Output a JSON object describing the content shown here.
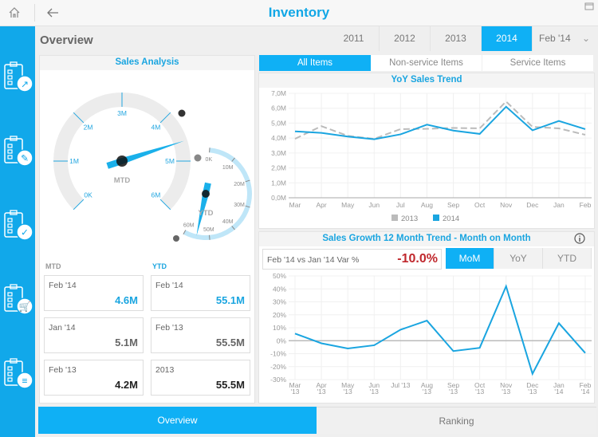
{
  "header": {
    "title": "Inventory",
    "home_icon": "home-icon",
    "back_icon": "back-arrow-icon"
  },
  "sidebar": {
    "items": [
      {
        "icon": "clipboard-trend-icon"
      },
      {
        "icon": "clipboard-tools-icon"
      },
      {
        "icon": "clipboard-check-icon"
      },
      {
        "icon": "clipboard-cart-icon"
      },
      {
        "icon": "clipboard-list-icon"
      }
    ]
  },
  "page_title": "Overview",
  "years": [
    "2011",
    "2012",
    "2013",
    "2014"
  ],
  "selected_year": "2014",
  "month_select": "Feb '14",
  "item_tabs": [
    "All Items",
    "Non-service Items",
    "Service Items"
  ],
  "sales_analysis": {
    "title": "Sales Analysis",
    "mtd_gauge": {
      "label": "MTD",
      "value": 4.6,
      "ticks": [
        "0K",
        "1M",
        "2M",
        "3M",
        "4M",
        "5M",
        "6M"
      ]
    },
    "ytd_gauge": {
      "label": "YTD",
      "value": 55.1,
      "ticks": [
        "0K",
        "10M",
        "20M",
        "30M",
        "40M",
        "50M",
        "60M"
      ]
    },
    "mtd_label": "MTD",
    "ytd_label": "YTD",
    "mtd_cards": [
      {
        "label": "Feb '14",
        "value": "4.6M"
      },
      {
        "label": "Jan '14",
        "value": "5.1M"
      },
      {
        "label": "Feb '13",
        "value": "4.2M"
      }
    ],
    "ytd_cards": [
      {
        "label": "Feb '14",
        "value": "55.1M"
      },
      {
        "label": "Feb '13",
        "value": "55.5M"
      },
      {
        "label": "2013",
        "value": "55.5M"
      }
    ]
  },
  "colors": {
    "accent": "#0fb0f5",
    "series_2013": "#bbbbbb",
    "series_2014": "#1aa5e0",
    "negative": "#c0282d"
  },
  "chart_data": [
    {
      "type": "line",
      "title": "YoY Sales Trend",
      "categories": [
        "Mar",
        "Apr",
        "May",
        "Jun",
        "Jul",
        "Aug",
        "Sep",
        "Oct",
        "Nov",
        "Dec",
        "Jan",
        "Feb"
      ],
      "yticks": [
        "0,0M",
        "1,0M",
        "2,0M",
        "3,0M",
        "4,0M",
        "5,0M",
        "6,0M",
        "7,0M"
      ],
      "ylim": [
        0,
        7
      ],
      "unit": "M",
      "grid": true,
      "legend": "bottom",
      "series": [
        {
          "name": "2013",
          "style": "dashed",
          "values": [
            3.95,
            4.8,
            4.15,
            3.95,
            4.6,
            4.62,
            4.68,
            4.65,
            6.45,
            4.75,
            4.65,
            4.22
          ]
        },
        {
          "name": "2014",
          "style": "solid",
          "values": [
            4.45,
            4.35,
            4.1,
            3.92,
            4.25,
            4.9,
            4.5,
            4.28,
            6.1,
            4.52,
            5.15,
            4.6
          ]
        }
      ]
    },
    {
      "type": "line",
      "title": "Sales Growth 12 Month Trend - Month on Month",
      "categories": [
        [
          "Mar",
          "'13"
        ],
        [
          "Apr",
          "'13"
        ],
        [
          "May",
          "'13"
        ],
        [
          "Jun",
          "'13"
        ],
        [
          "Jul '13",
          ""
        ],
        [
          "Aug",
          "'13"
        ],
        [
          "Sep",
          "'13"
        ],
        [
          "Oct",
          "'13"
        ],
        [
          "Nov",
          "'13"
        ],
        [
          "Dec",
          "'13"
        ],
        [
          "Jan",
          "'14"
        ],
        [
          "Feb",
          "'14"
        ]
      ],
      "yticks": [
        "-30%",
        "-20%",
        "-10%",
        "0%",
        "10%",
        "20%",
        "30%",
        "40%",
        "50%"
      ],
      "ylim": [
        -30,
        50
      ],
      "grid": true,
      "series": [
        {
          "values": [
            5.5,
            -2,
            -6,
            -3.5,
            8.5,
            15.5,
            -8,
            -5.5,
            42,
            -25.5,
            13.5,
            -9.5
          ]
        }
      ]
    }
  ],
  "growth": {
    "var_label": "Feb '14 vs Jan '14 Var %",
    "var_value": "-10.0%",
    "modes": [
      "MoM",
      "YoY",
      "YTD"
    ],
    "selected": "MoM",
    "info_icon": "info-icon"
  },
  "bottom_tabs": [
    "Overview",
    "Ranking"
  ]
}
